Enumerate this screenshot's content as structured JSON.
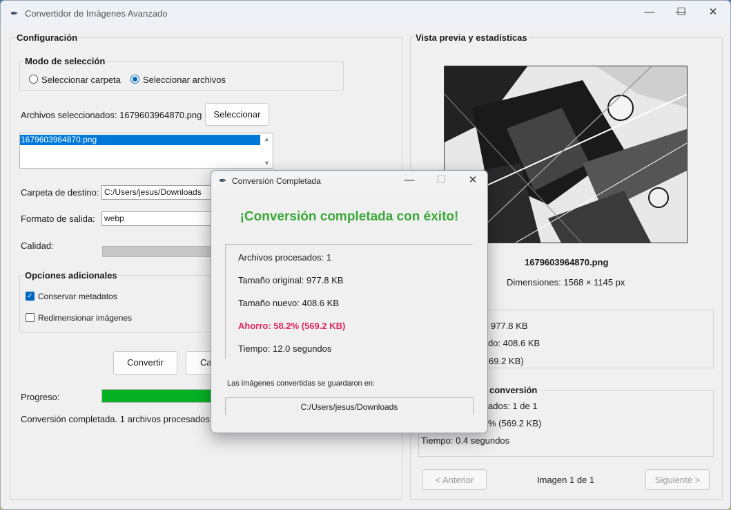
{
  "window": {
    "title": "Convertidor de Imágenes Avanzado",
    "minimize_glyph": "—",
    "maximize_glyph": "☐",
    "close_glyph": "✕"
  },
  "config": {
    "group_title": "Configuración",
    "selection_mode": {
      "title": "Modo de selección",
      "options": [
        "Seleccionar carpeta",
        "Seleccionar archivos"
      ],
      "selected": "Seleccionar archivos"
    },
    "selected_files_label": "Archivos seleccionados: 1679603964870.png",
    "select_button": "Seleccionar",
    "file_list": [
      "1679603964870.png"
    ],
    "destination_label": "Carpeta de destino:",
    "destination_value": "C:/Users/jesus/Downloads",
    "format_label": "Formato de salida:",
    "format_value": "webp",
    "quality_label": "Calidad:",
    "additional_options": {
      "title": "Opciones adicionales",
      "preserve_metadata": "Conservar metadatos",
      "preserve_metadata_checked": true,
      "resize_images": "Redimensionar imágenes",
      "resize_images_checked": false
    },
    "convert_button": "Convertir",
    "cancel_button_partial": "Ca",
    "progress_label": "Progreso:",
    "progress_value": 1.0,
    "status_text": "Conversión completada. 1 archivos procesados."
  },
  "preview": {
    "group_title": "Vista previa y estadísticas",
    "file_name": "1679603964870.png",
    "dimensions": "Dimensiones: 1568 × 1145 px",
    "stats_visible": {
      "line1": "977.8 KB",
      "line2": "do: 408.6 KB",
      "line3": "69.2 KB)"
    },
    "conversion_title_partial": "conversión",
    "conv_visible": {
      "line1": "ados: 1 de 1",
      "line2": "% (569.2 KB)",
      "line3": "Tiempo: 0.4 segundos"
    },
    "prev_button": "< Anterior",
    "page_indicator": "Imagen 1 de 1",
    "next_button": "Siguiente >"
  },
  "dialog": {
    "title": "Conversión Completada",
    "heading": "¡Conversión completada con éxito!",
    "processed": "Archivos procesados: 1",
    "original_size": "Tamaño original: 977.8 KB",
    "new_size": "Tamaño nuevo: 408.6 KB",
    "saving": "Ahorro: 58.2% (569.2 KB)",
    "time": "Tiempo: 12.0 segundos",
    "saved_in_label": "Las imágenes convertidas se guardaron en:",
    "saved_path": "C:/Users/jesus/Downloads",
    "colors": {
      "heading": "#3aa83a",
      "saving": "#e0245e"
    }
  },
  "colors": {
    "accent": "#0067c0",
    "progress": "#06b025",
    "selection": "#0078d7"
  }
}
